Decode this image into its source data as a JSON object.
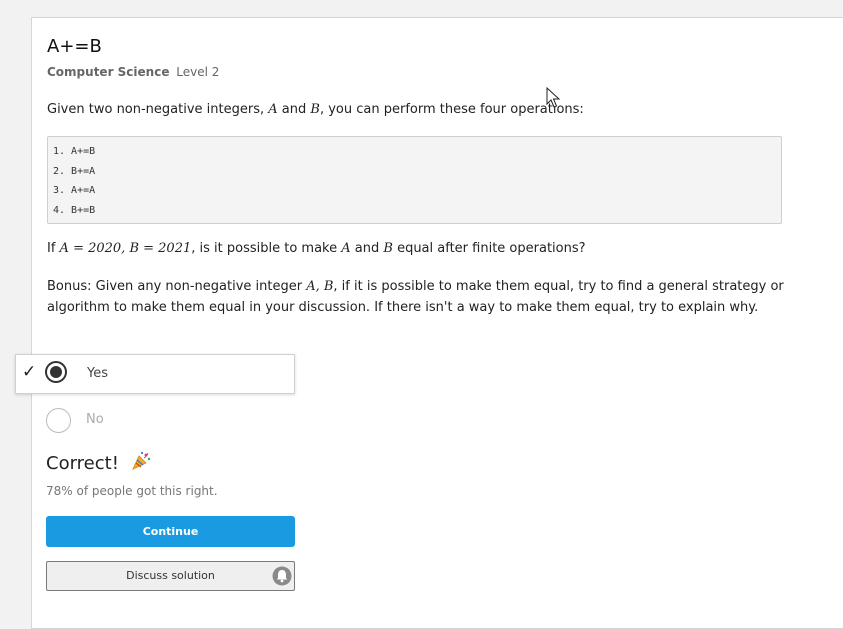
{
  "problem": {
    "title": "A+=B",
    "subject": "Computer Science",
    "level": "Level 2",
    "intro": {
      "p1": "Given two non-negative integers, ",
      "a": "A",
      "p2": " and ",
      "b": "B",
      "p3": ", you can perform these four operations:"
    },
    "operations": [
      {
        "num": "1.",
        "text": "A+=B"
      },
      {
        "num": "2.",
        "text": "B+=A"
      },
      {
        "num": "3.",
        "text": "A+=A"
      },
      {
        "num": "4.",
        "text": "B+=B"
      }
    ],
    "question": {
      "p1": "If ",
      "math1": "A = 2020, B = 2021",
      "p2": ", is it possible to make ",
      "a": "A",
      "p3": " and ",
      "b": "B",
      "p4": " equal after ",
      "finite": "finite",
      "p5": " operations?"
    },
    "bonus": {
      "p1": "Bonus: Given any non-negative integer ",
      "math": "A, B",
      "p2": ", if it is possible to make them equal, try to find a general strategy or algorithm to make them equal in your discussion. If there isn't a way to make them equal, try to explain why."
    }
  },
  "answer": {
    "options": [
      "Yes",
      "No"
    ],
    "selected": "Yes",
    "checkmark": "✓"
  },
  "result": {
    "title": "Correct!",
    "stat": "78% of people got this right."
  },
  "buttons": {
    "continue": "Continue",
    "discuss": "Discuss solution"
  },
  "icons": {
    "party": "party-popper-icon",
    "bell": "bell-icon",
    "cursor": "mouse-cursor-icon"
  },
  "colors": {
    "accent": "#1a9ae0",
    "card_bg": "#ffffff",
    "page_bg": "#f2f2f2"
  }
}
